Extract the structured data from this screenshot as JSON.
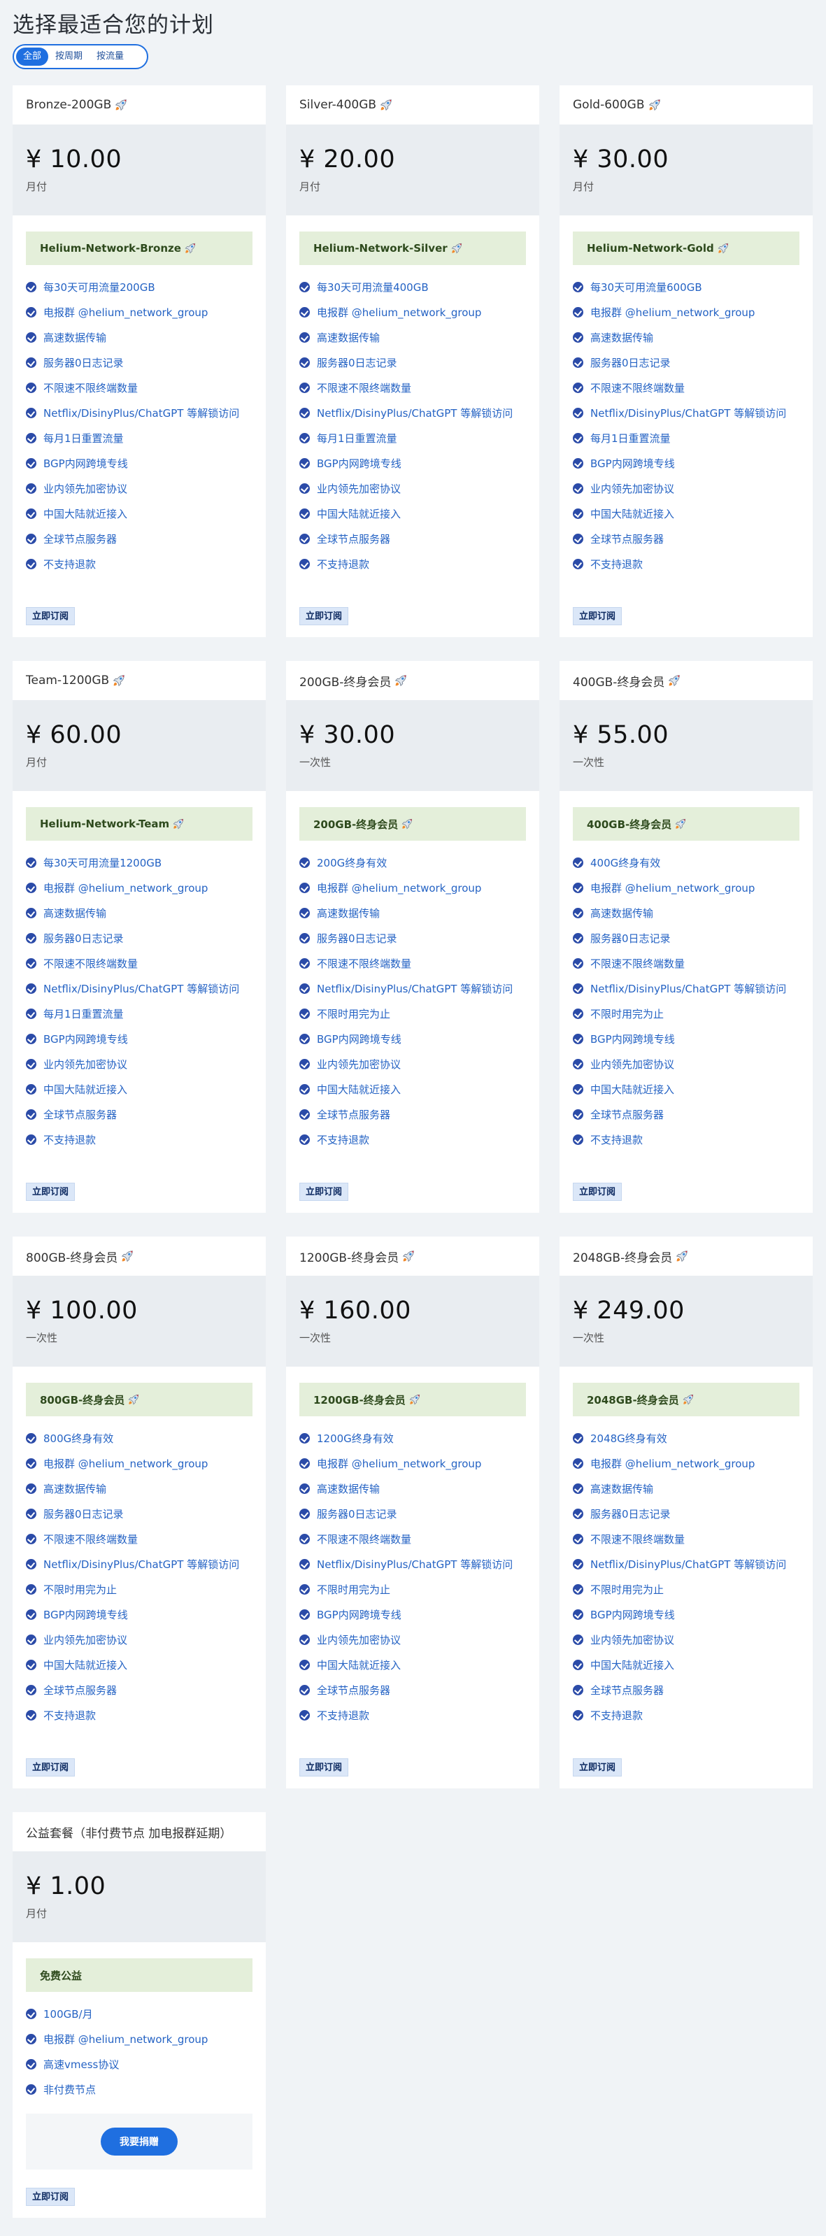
{
  "page": {
    "title": "选择最适合您的计划"
  },
  "filter": {
    "options": [
      "全部",
      "按周期",
      "按流量"
    ],
    "active": 0
  },
  "colors": {
    "accent": "#1f6fe0",
    "tag_bg": "#e4efda",
    "price_bg": "#e9edf1",
    "feature_text": "#2563c4",
    "check": "#2b4ba8"
  },
  "order_label": "立即订阅",
  "donate_label": "我要捐赠",
  "plans": [
    {
      "name": "Bronze-200GB",
      "rocket": true,
      "price": "¥ 10.00",
      "period": "月付",
      "tag": "Helium-Network-Bronze",
      "tag_rocket": true,
      "features": [
        "每30天可用流量200GB",
        "电报群 @helium_network_group",
        "高速数据传输",
        "服务器0日志记录",
        "不限速不限终端数量",
        "Netflix/DisinyPlus/ChatGPT 等解锁访问",
        "每月1日重置流量",
        "BGP内网跨境专线",
        "业内领先加密协议",
        "中国大陆就近接入",
        "全球节点服务器",
        "不支持退款"
      ]
    },
    {
      "name": "Silver-400GB",
      "rocket": true,
      "price": "¥ 20.00",
      "period": "月付",
      "tag": "Helium-Network-Silver",
      "tag_rocket": true,
      "features": [
        "每30天可用流量400GB",
        "电报群 @helium_network_group",
        "高速数据传输",
        "服务器0日志记录",
        "不限速不限终端数量",
        "Netflix/DisinyPlus/ChatGPT 等解锁访问",
        "每月1日重置流量",
        "BGP内网跨境专线",
        "业内领先加密协议",
        "中国大陆就近接入",
        "全球节点服务器",
        "不支持退款"
      ]
    },
    {
      "name": "Gold-600GB",
      "rocket": true,
      "price": "¥ 30.00",
      "period": "月付",
      "tag": "Helium-Network-Gold",
      "tag_rocket": true,
      "features": [
        "每30天可用流量600GB",
        "电报群 @helium_network_group",
        "高速数据传输",
        "服务器0日志记录",
        "不限速不限终端数量",
        "Netflix/DisinyPlus/ChatGPT 等解锁访问",
        "每月1日重置流量",
        "BGP内网跨境专线",
        "业内领先加密协议",
        "中国大陆就近接入",
        "全球节点服务器",
        "不支持退款"
      ]
    },
    {
      "name": "Team-1200GB",
      "rocket": true,
      "price": "¥ 60.00",
      "period": "月付",
      "tag": "Helium-Network-Team",
      "tag_rocket": true,
      "features": [
        "每30天可用流量1200GB",
        "电报群 @helium_network_group",
        "高速数据传输",
        "服务器0日志记录",
        "不限速不限终端数量",
        "Netflix/DisinyPlus/ChatGPT 等解锁访问",
        "每月1日重置流量",
        "BGP内网跨境专线",
        "业内领先加密协议",
        "中国大陆就近接入",
        "全球节点服务器",
        "不支持退款"
      ]
    },
    {
      "name": "200GB-终身会员",
      "rocket": true,
      "price": "¥ 30.00",
      "period": "一次性",
      "tag": "200GB-终身会员",
      "tag_rocket": true,
      "features": [
        "200G终身有效",
        "电报群 @helium_network_group",
        "高速数据传输",
        "服务器0日志记录",
        "不限速不限终端数量",
        "Netflix/DisinyPlus/ChatGPT 等解锁访问",
        "不限时用完为止",
        "BGP内网跨境专线",
        "业内领先加密协议",
        "中国大陆就近接入",
        "全球节点服务器",
        "不支持退款"
      ]
    },
    {
      "name": "400GB-终身会员",
      "rocket": true,
      "price": "¥ 55.00",
      "period": "一次性",
      "tag": "400GB-终身会员",
      "tag_rocket": true,
      "features": [
        "400G终身有效",
        "电报群 @helium_network_group",
        "高速数据传输",
        "服务器0日志记录",
        "不限速不限终端数量",
        "Netflix/DisinyPlus/ChatGPT 等解锁访问",
        "不限时用完为止",
        "BGP内网跨境专线",
        "业内领先加密协议",
        "中国大陆就近接入",
        "全球节点服务器",
        "不支持退款"
      ]
    },
    {
      "name": "800GB-终身会员",
      "rocket": true,
      "price": "¥ 100.00",
      "period": "一次性",
      "tag": "800GB-终身会员",
      "tag_rocket": true,
      "features": [
        "800G终身有效",
        "电报群 @helium_network_group",
        "高速数据传输",
        "服务器0日志记录",
        "不限速不限终端数量",
        "Netflix/DisinyPlus/ChatGPT 等解锁访问",
        "不限时用完为止",
        "BGP内网跨境专线",
        "业内领先加密协议",
        "中国大陆就近接入",
        "全球节点服务器",
        "不支持退款"
      ]
    },
    {
      "name": "1200GB-终身会员",
      "rocket": true,
      "price": "¥ 160.00",
      "period": "一次性",
      "tag": "1200GB-终身会员",
      "tag_rocket": true,
      "features": [
        "1200G终身有效",
        "电报群 @helium_network_group",
        "高速数据传输",
        "服务器0日志记录",
        "不限速不限终端数量",
        "Netflix/DisinyPlus/ChatGPT 等解锁访问",
        "不限时用完为止",
        "BGP内网跨境专线",
        "业内领先加密协议",
        "中国大陆就近接入",
        "全球节点服务器",
        "不支持退款"
      ]
    },
    {
      "name": "2048GB-终身会员",
      "rocket": true,
      "price": "¥ 249.00",
      "period": "一次性",
      "tag": "2048GB-终身会员",
      "tag_rocket": true,
      "features": [
        "2048G终身有效",
        "电报群 @helium_network_group",
        "高速数据传输",
        "服务器0日志记录",
        "不限速不限终端数量",
        "Netflix/DisinyPlus/ChatGPT 等解锁访问",
        "不限时用完为止",
        "BGP内网跨境专线",
        "业内领先加密协议",
        "中国大陆就近接入",
        "全球节点服务器",
        "不支持退款"
      ]
    },
    {
      "name": "公益套餐（非付费节点 加电报群延期）",
      "rocket": false,
      "price": "¥ 1.00",
      "period": "月付",
      "tag": "免费公益",
      "tag_rocket": false,
      "features": [
        "100GB/月",
        "电报群 @helium_network_group",
        "高速vmess协议",
        "非付费节点"
      ],
      "donate": true
    }
  ]
}
